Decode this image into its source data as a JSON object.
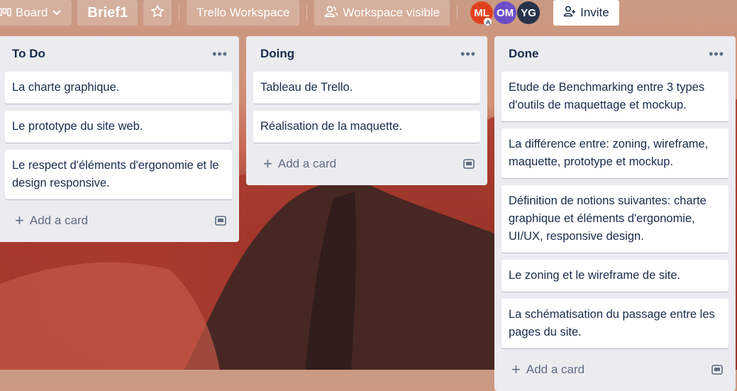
{
  "header": {
    "board_label": "Board",
    "board_title": "Brief1",
    "workspace_label": "Trello Workspace",
    "visibility_label": "Workspace visible",
    "members": [
      {
        "initials": "ML",
        "color": "#e2401c"
      },
      {
        "initials": "OM",
        "color": "#6d4ec7"
      },
      {
        "initials": "YG",
        "color": "#26334a"
      }
    ],
    "invite_label": "Invite"
  },
  "lists": [
    {
      "title": "To Do",
      "cards": [
        "La charte graphique.",
        "Le prototype du site web.",
        "Le respect d'éléments d'ergonomie et le design responsive."
      ],
      "add_label": "Add a card"
    },
    {
      "title": "Doing",
      "cards": [
        "Tableau de Trello.",
        "Réalisation de la maquette."
      ],
      "add_label": "Add a card"
    },
    {
      "title": "Done",
      "cards": [
        "Etude de Benchmarking entre 3 types d'outils de maquettage et mockup.",
        "La différence entre: zoning, wireframe, maquette, prototype et mockup.",
        "Définition de notions suivantes: charte graphique et éléments d'ergonomie, UI/UX, responsive design.",
        "Le zoning et le wireframe de site.",
        "La schématisation du passage entre les pages du site."
      ],
      "add_label": "Add a card"
    }
  ],
  "colors": {
    "list_bg": "#ebecf0",
    "card_bg": "#ffffff",
    "text": "#172b4d",
    "muted": "#5e6c84"
  }
}
